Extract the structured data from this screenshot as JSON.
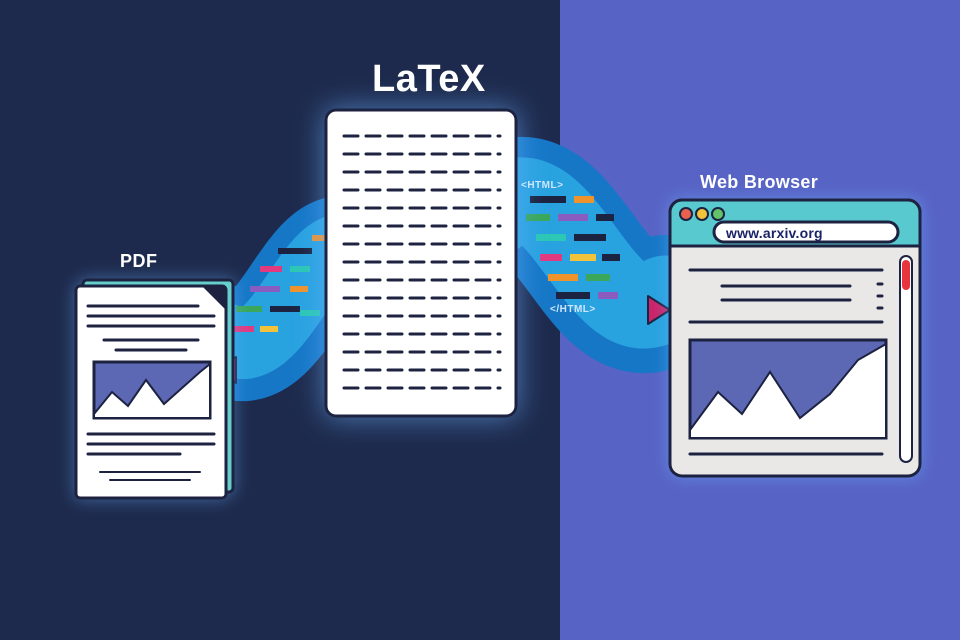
{
  "labels": {
    "pdf": "PDF",
    "latex": "LaTeX",
    "browser": "Web Browser"
  },
  "browser_url": "www.arxiv.org",
  "html_open": "<HTML>",
  "html_close": "</HTML>",
  "colors": {
    "bg_left": "#1d2a4d",
    "bg_right": "#5763c5",
    "flow_light": "#29a2e0",
    "flow_dark": "#1677c7",
    "doc_white": "#ffffff",
    "doc_outline": "#1b2340",
    "browser_header": "#58c9cf",
    "browser_body": "#e9e8e6",
    "scroll_track": "#e9e8e6",
    "scroll_thumb": "#e8353e",
    "chart_fill": "#5d68b4",
    "arrow_magenta": "#c9256a",
    "ear_teal": "#66cfcc",
    "tl_red": "#e8604f",
    "tl_yellow": "#f2c23a",
    "tl_green": "#62c36a",
    "snip_navy": "#1b2340",
    "snip_magenta": "#e23a7f",
    "snip_teal": "#2cc7b5",
    "snip_orange": "#f1932b",
    "snip_purple": "#8a5cc0",
    "snip_green": "#3aa75a",
    "snip_yellow": "#f2c23a"
  },
  "concept": "LaTeX source renders to PDF and to HTML in a web browser"
}
